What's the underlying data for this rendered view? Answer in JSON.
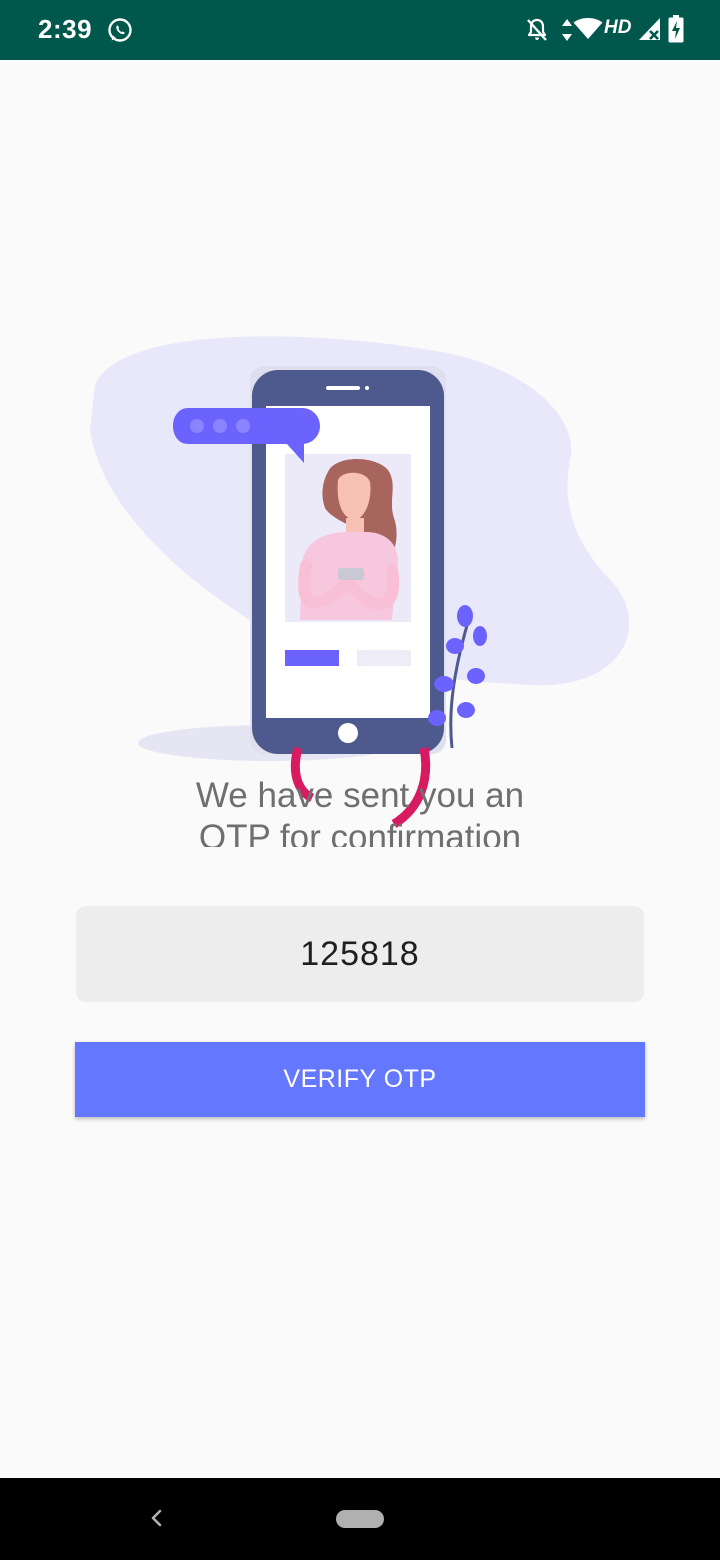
{
  "status_bar": {
    "time": "2:39",
    "network_label": "HD",
    "icons": [
      "whatsapp-icon",
      "notifications-off-icon",
      "data-arrows-icon",
      "wifi-icon",
      "signal-icon",
      "battery-charging-icon"
    ]
  },
  "illustration": {
    "name": "otp-sent-illustration",
    "colors": {
      "blob": "#E9E8FA",
      "phone": "#4E5A8E",
      "accent": "#6C63FF",
      "hair": "#A8655E",
      "shirt": "#F7C7DE",
      "spinner": "#D81B60"
    }
  },
  "message": {
    "line1": "We have sent you an",
    "line2": "OTP for confirmation"
  },
  "otp_input": {
    "value": "125818"
  },
  "verify_button": {
    "label": "VERIFY OTP",
    "color": "#6478FF"
  },
  "nav_bar": {
    "icons": [
      "back-icon",
      "home-pill-icon"
    ]
  }
}
